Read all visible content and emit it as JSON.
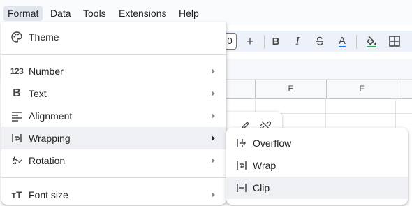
{
  "menubar": {
    "items": [
      {
        "label": "Format",
        "active": true
      },
      {
        "label": "Data"
      },
      {
        "label": "Tools"
      },
      {
        "label": "Extensions"
      },
      {
        "label": "Help"
      }
    ]
  },
  "toolbar": {
    "font_size_fragment": "0",
    "increase_label": "+",
    "bold_label": "B",
    "italic_label": "I",
    "text_color_label": "A",
    "text_color": "#1a73e8"
  },
  "columns": [
    {
      "label": "E"
    },
    {
      "label": "F"
    }
  ],
  "format_menu": {
    "items": [
      {
        "label": "Theme",
        "icon": "palette-icon",
        "submenu": false
      },
      {
        "label": "Number",
        "icon": "number-format-icon",
        "submenu": true
      },
      {
        "label": "Text",
        "icon": "bold-text-icon",
        "submenu": true
      },
      {
        "label": "Alignment",
        "icon": "align-left-icon",
        "submenu": true
      },
      {
        "label": "Wrapping",
        "icon": "wrap-text-icon",
        "submenu": true,
        "hover": true
      },
      {
        "label": "Rotation",
        "icon": "text-rotation-icon",
        "submenu": true
      },
      {
        "label": "Font size",
        "icon": "font-size-icon",
        "submenu": true
      }
    ],
    "number_icon_text": "123",
    "text_icon_text": "B",
    "fontsize_icon_text": "тT"
  },
  "wrapping_submenu": {
    "items": [
      {
        "label": "Overflow",
        "icon": "overflow-icon"
      },
      {
        "label": "Wrap",
        "icon": "wrap-icon"
      },
      {
        "label": "Clip",
        "icon": "clip-icon",
        "hover": true
      }
    ]
  }
}
